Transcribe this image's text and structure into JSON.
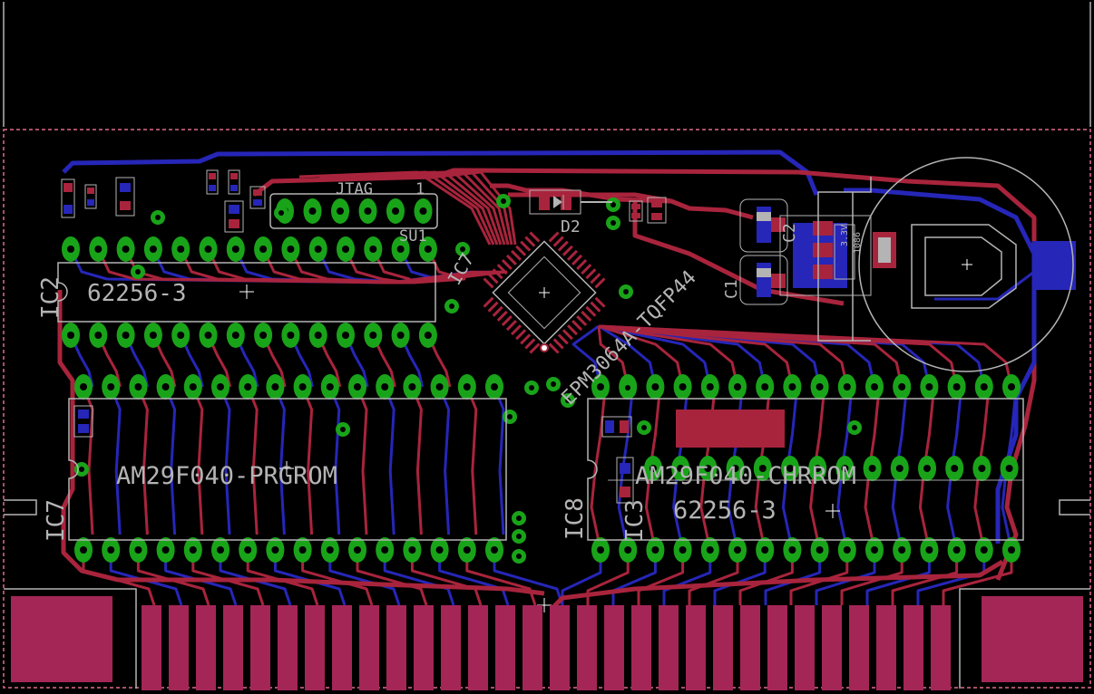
{
  "colors": {
    "background": "#000000",
    "bottom_copper": "#2626b8",
    "top_copper": "#a8243c",
    "pad": "#19a319",
    "silkscreen": "#b4b4b4",
    "outline": "#e06a8a",
    "edge_connector": "#a32656"
  },
  "labels": {
    "ic2_ref": "IC2",
    "ic2_value": "62256-3",
    "jtag": "JTAG",
    "jtag_pin1": "1",
    "su1": "SU1",
    "ic7_top_ref": "IC7",
    "d2": "D2",
    "cpld": "EPM3064A-TQFP44",
    "c1": "C1",
    "c2": "C2",
    "reg": "3.3V",
    "reg_part": "1086",
    "ic7_ref": "IC7",
    "prgrom": "AM29F040-PRGROM",
    "ic8_ref": "IC8",
    "chrrom": "AM29F040-CHRROM",
    "ic3_value": "62256-3",
    "ic3_ref": "IC3"
  }
}
